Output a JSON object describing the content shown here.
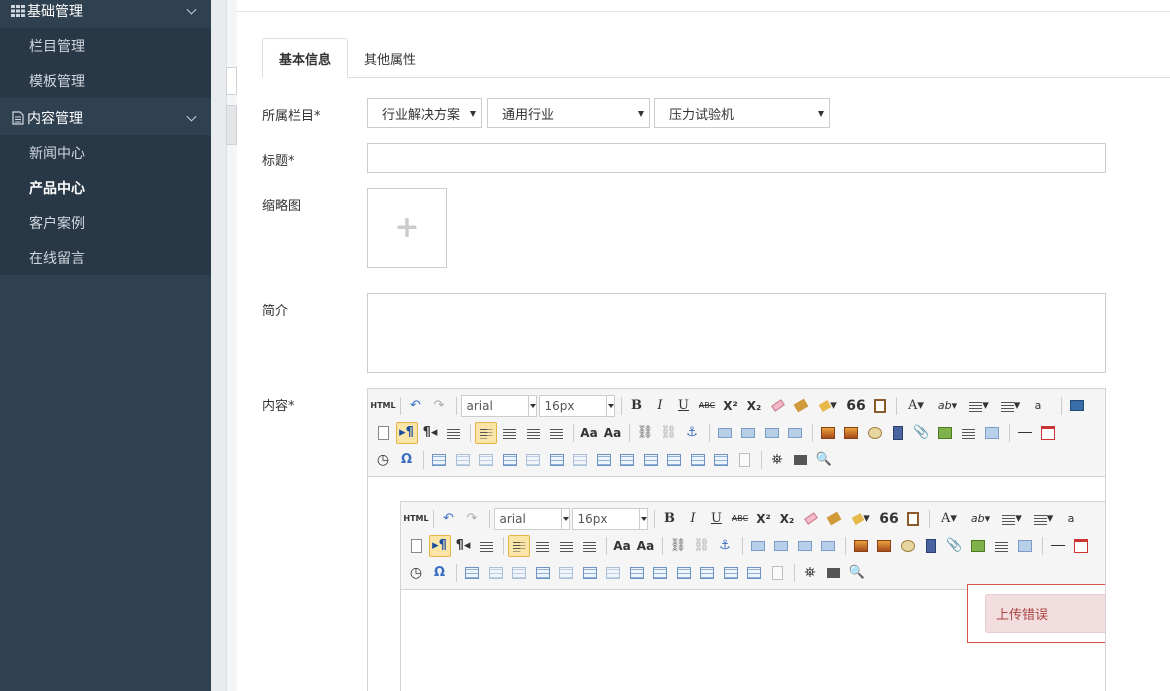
{
  "sidebar": {
    "groups": [
      {
        "label": "基础管理",
        "icon": "grid-icon",
        "items": [
          {
            "label": "栏目管理"
          },
          {
            "label": "模板管理"
          }
        ]
      },
      {
        "label": "内容管理",
        "icon": "document-icon",
        "items": [
          {
            "label": "新闻中心"
          },
          {
            "label": "产品中心",
            "active": true
          },
          {
            "label": "客户案例"
          },
          {
            "label": "在线留言"
          }
        ]
      }
    ]
  },
  "tabs": [
    {
      "label": "基本信息",
      "active": true
    },
    {
      "label": "其他属性"
    }
  ],
  "form": {
    "category_label": "所属栏目*",
    "category_selects": [
      "行业解决方案",
      "通用行业",
      "压力试验机"
    ],
    "title_label": "标题*",
    "title_value": "",
    "thumbnail_label": "缩略图",
    "thumbnail_add": "+",
    "summary_label": "简介",
    "summary_value": "",
    "content_label": "内容*"
  },
  "editor": {
    "html_button": "HTML",
    "font_family": "arial",
    "font_size": "16px",
    "bold": "B",
    "italic": "I",
    "underline": "U",
    "strikethrough": "ABC",
    "superscript": "X²",
    "subscript": "X₂",
    "quote": "66",
    "font_color": "A",
    "omega": "Ω",
    "error_message": "上传错误"
  },
  "colors": {
    "sidebar_bg": "#2f4050",
    "active_button": "#fbe5a6",
    "error_bg": "#f2dede",
    "error_text": "#a94442"
  }
}
